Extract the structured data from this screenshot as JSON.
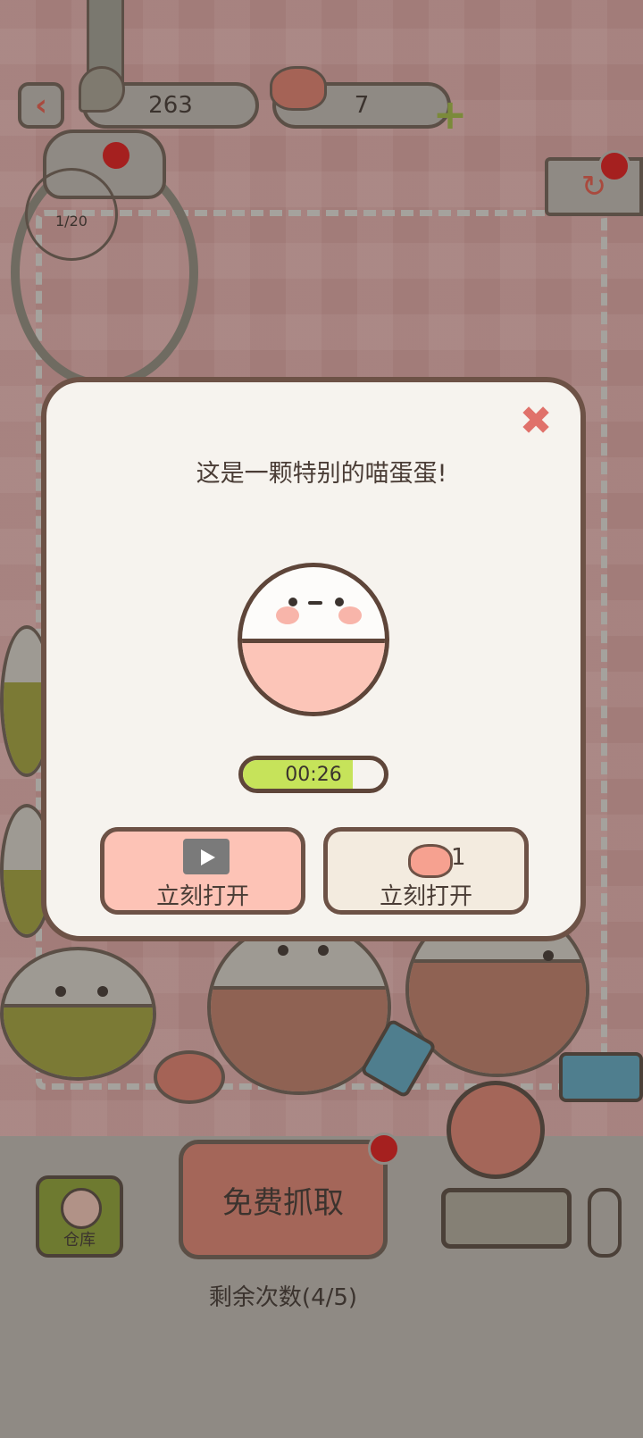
{
  "header": {
    "fish_count": "263",
    "heart_count": "7"
  },
  "claw": {
    "progress": "1/20"
  },
  "dialog": {
    "title": "这是一颗特别的喵蛋蛋!",
    "timer": "00:26",
    "timer_fraction": 0.78,
    "ad_button_label": "立刻打开",
    "heart_button_label": "立刻打开",
    "heart_cost": "1"
  },
  "bottom": {
    "warehouse_label": "仓库",
    "grab_label": "免费抓取",
    "remaining_text": "剩余次数(4/5)"
  },
  "colors": {
    "dialog_bg": "#f6f3ee",
    "dialog_border": "#6d5246",
    "close": "#e0716a",
    "timer_fill": "#c6e35a",
    "egg_bottom": "#fcc5b8",
    "ad_button": "#fdc3b6",
    "heart_button": "#f3ebdf",
    "overlay": "#8f8a84"
  },
  "icons": [
    "back-arrow-icon",
    "fish-icon",
    "heart-icon",
    "plus-icon",
    "refresh-icon",
    "close-icon",
    "video-icon",
    "book-icon",
    "ticket-icon"
  ]
}
